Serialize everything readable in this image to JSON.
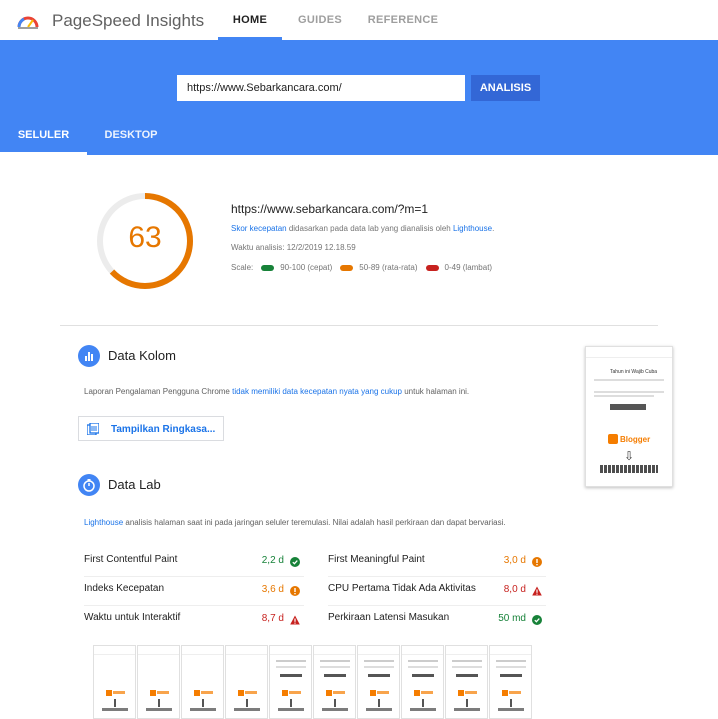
{
  "header": {
    "app_title": "PageSpeed Insights",
    "nav": [
      "HOME",
      "GUIDES",
      "REFERENCE"
    ]
  },
  "search": {
    "url_value": "https://www.Sebarkancara.com/",
    "analyze_label": "ANALISIS"
  },
  "device_tabs": [
    "SELULER",
    "DESKTOP"
  ],
  "summary": {
    "score": "63",
    "score_value": 63,
    "score_color": "#e67700",
    "final_url": "https://www.sebarkancara.com/?m=1",
    "desc_link1": "Skor kecepatan",
    "desc_mid": " didasarkan pada data lab yang dianalisis oleh ",
    "desc_link2": "Lighthouse",
    "desc_end": ".",
    "analysis_time": "Waktu analisis: 12/2/2019 12.18.59",
    "scale_label": "Scale:",
    "scale": [
      {
        "label": "90-100 (cepat)",
        "color": "#178239"
      },
      {
        "label": "50-89 (rata-rata)",
        "color": "#e67700"
      },
      {
        "label": "0-49 (lambat)",
        "color": "#c7221f"
      }
    ]
  },
  "field_data": {
    "title": "Data Kolom",
    "desc_start": "Laporan Pengalaman Pengguna Chrome ",
    "desc_link": "tidak memiliki data kecepatan nyata yang cukup",
    "desc_end": " untuk halaman ini.",
    "summary_button": "Tampilkan Ringkasa..."
  },
  "lab_data": {
    "title": "Data Lab",
    "desc_link": "Lighthouse",
    "desc_rest": " analisis halaman saat ini pada jaringan seluler teremulasi. Nilai adalah hasil perkiraan dan dapat bervariasi.",
    "metrics_left": [
      {
        "label": "First Contentful Paint",
        "value": "2,2 d",
        "status": "pass",
        "color": "#178239"
      },
      {
        "label": "Indeks Kecepatan",
        "value": "3,6 d",
        "status": "average",
        "color": "#e67700"
      },
      {
        "label": "Waktu untuk Interaktif",
        "value": "8,7 d",
        "status": "fail",
        "color": "#c7221f"
      }
    ],
    "metrics_right": [
      {
        "label": "First Meaningful Paint",
        "value": "3,0 d",
        "status": "average",
        "color": "#e67700"
      },
      {
        "label": "CPU Pertama Tidak Ada Aktivitas",
        "value": "8,0 d",
        "status": "fail",
        "color": "#c7221f"
      },
      {
        "label": "Perkiraan Latensi Masukan",
        "value": "50 md",
        "status": "pass",
        "color": "#178239"
      }
    ]
  },
  "screenshot_preview": {
    "brand": "Blogger",
    "headline": "Tahun ini Wajib Cuba"
  },
  "filmstrip_frames": 10,
  "colors": {
    "brand_blue": "#4285f4",
    "button_blue": "#3367d6",
    "link": "#1a73e8"
  }
}
